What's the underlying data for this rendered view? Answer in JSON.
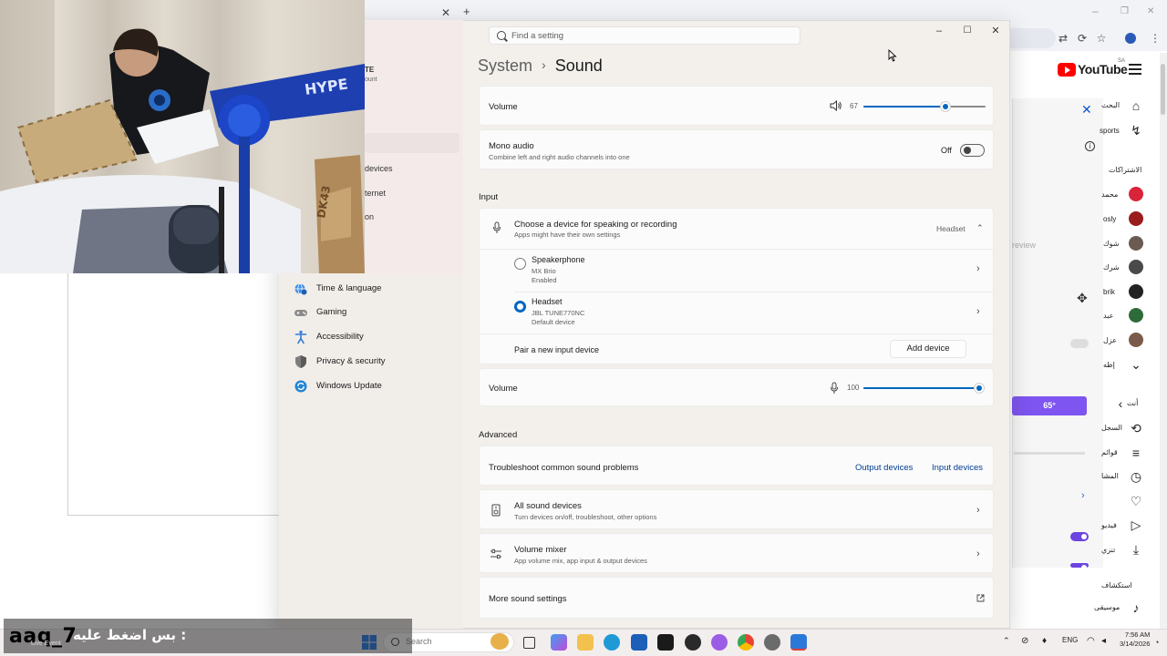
{
  "background_browser": {
    "youtube_logo": "YouTube",
    "youtube_region": "SA",
    "sidebar_texts": [
      "البحث",
      "sports",
      "الاشتراكات",
      "محمد",
      "osly",
      "شوك",
      "شرك",
      "brik",
      "عبد",
      "عزل",
      "إظه",
      "أنت",
      "السجل",
      "قوائم",
      "المشا",
      "فيديو",
      "تنزي",
      "استكشاف",
      "موسيقى"
    ],
    "panel_preview": "review",
    "temperature_button": "65°"
  },
  "settings": {
    "search_placeholder": "Find a setting",
    "breadcrumb": {
      "system": "System",
      "separator": "›",
      "page": "Sound"
    },
    "nav_fragments": [
      "TE",
      "ount",
      "devices",
      "ternet",
      "on"
    ],
    "nav": [
      {
        "label": "Time & language",
        "icon": "globe-clock-icon"
      },
      {
        "label": "Gaming",
        "icon": "gamepad-icon"
      },
      {
        "label": "Accessibility",
        "icon": "accessibility-icon"
      },
      {
        "label": "Privacy & security",
        "icon": "shield-icon"
      },
      {
        "label": "Windows Update",
        "icon": "update-icon"
      }
    ],
    "output": {
      "volume_label": "Volume",
      "volume_value": "67",
      "volume_percent": 67,
      "mono_title": "Mono audio",
      "mono_desc": "Combine left and right audio channels into one",
      "mono_state": "Off"
    },
    "input": {
      "section": "Input",
      "choose_title": "Choose a device for speaking or recording",
      "choose_desc": "Apps might have their own settings",
      "choose_value": "Headset",
      "devices": [
        {
          "name": "Speakerphone",
          "model": "MX Brio",
          "status": "Enabled",
          "selected": false
        },
        {
          "name": "Headset",
          "model": "JBL TUNE770NC",
          "status": "Default device",
          "selected": true
        }
      ],
      "pair_label": "Pair a new input device",
      "add_button": "Add device",
      "volume_label": "Volume",
      "volume_value": "100",
      "volume_percent": 100
    },
    "advanced": {
      "section": "Advanced",
      "troubleshoot_label": "Troubleshoot common sound problems",
      "output_link": "Output devices",
      "input_link": "Input devices",
      "all_devices_title": "All sound devices",
      "all_devices_desc": "Turn devices on/off, troubleshoot, other options",
      "mixer_title": "Volume mixer",
      "mixer_desc": "App volume mix, app input & output devices",
      "more_settings": "More sound settings"
    }
  },
  "taskbar": {
    "search_placeholder": "Search",
    "language": "ENG",
    "time": "7:56 AM",
    "date": "3/14/2026"
  },
  "overlay": {
    "name": "aaq_7",
    "text": "بس اضغط عليه :",
    "small": "Live Event"
  },
  "colors": {
    "accent": "#0067c0",
    "youtube_red": "#ff0000",
    "purple": "#7e55f0"
  }
}
